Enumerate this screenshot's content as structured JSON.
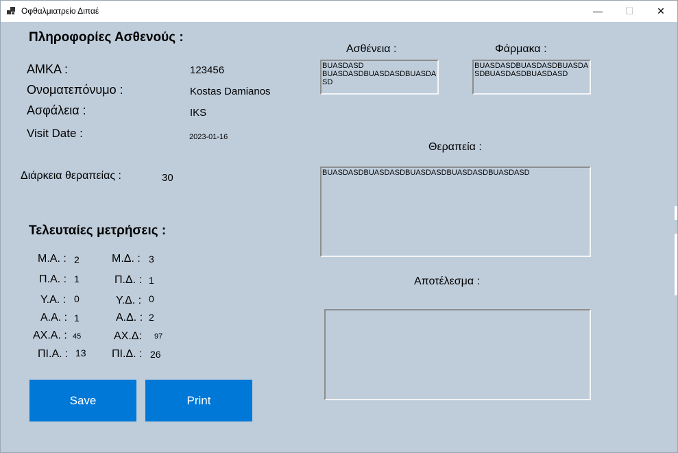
{
  "window": {
    "title": "Οφθαλμιατρείο Διπαέ",
    "minimize_glyph": "—",
    "maximize_glyph": "☐",
    "close_glyph": "✕",
    "icon": "app-window-icon"
  },
  "patient": {
    "heading": "Πληροφορίες Ασθενούς :",
    "amka_label": "ΑΜΚΑ :",
    "amka_value": "123456",
    "name_label": "Ονοματεπόνυμο :",
    "name_value": "Kostas Damianos",
    "insurance_label": "Ασφάλεια :",
    "insurance_value": "IKS",
    "visit_label": "Visit Date :",
    "visit_value": "2023-01-16",
    "duration_label": "Διάρκεια θεραπείας :",
    "duration_value": "30"
  },
  "measurements": {
    "heading": "Τελευταίες μετρήσεις :",
    "ma_label": "Μ.Α. :",
    "ma_value": "2",
    "md_label": "Μ.Δ. :",
    "md_value": "3",
    "pa_label": "Π.Α. :",
    "pa_value": "1",
    "pd_label": "Π.Δ. :",
    "pd_value": "1",
    "ya_label": "Υ.Α. :",
    "ya_value": "0",
    "yd_label": "Υ.Δ. :",
    "yd_value": "0",
    "aa_label": "Α.Α. :",
    "aa_value": "1",
    "ad_label": "Α.Δ. :",
    "ad_value": "2",
    "axa_label": "ΑΧ.Α. :",
    "axa_value": "45",
    "axd_label": "ΑΧ.Δ:",
    "axd_value": "97",
    "pia_label": "ΠΙ.Α. :",
    "pia_value": "13",
    "pid_label": "ΠΙ.Δ. :",
    "pid_value": "26"
  },
  "disease": {
    "label": "Ασθένεια :",
    "value": "BUASDASD\nBUASDASDBUASDASDBUASDASD"
  },
  "drugs": {
    "label": "Φάρμακα :",
    "value": "BUASDASDBUASDASDBUASDASDBUASDASDBUASDASD"
  },
  "therapy": {
    "label": "Θεραπεία :",
    "value": "BUASDASDBUASDASDBUASDASDBUASDASDBUASDASD"
  },
  "result": {
    "label": "Αποτέλεσμα :",
    "value": ""
  },
  "buttons": {
    "save": "Save",
    "print": "Print"
  }
}
